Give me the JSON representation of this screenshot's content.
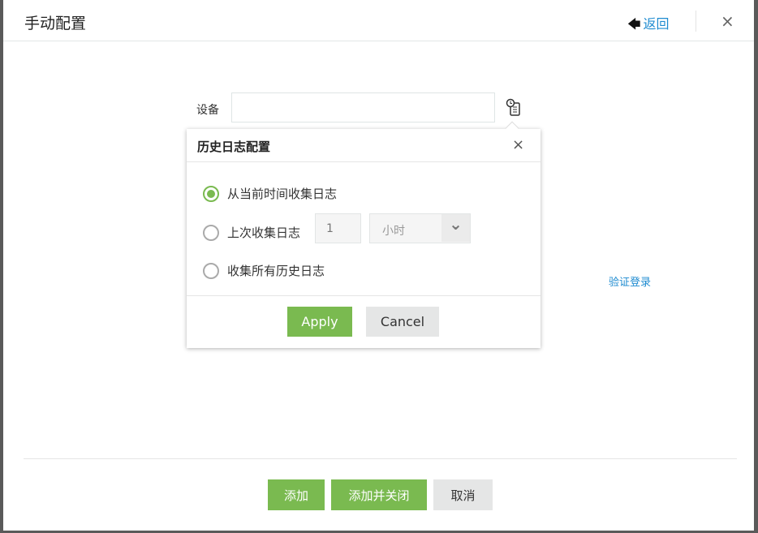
{
  "dialog": {
    "title": "手动配置",
    "back_label": "返回",
    "close_label": "×"
  },
  "form": {
    "device_label": "设备",
    "device_value": "",
    "verify_label": "验证登录"
  },
  "popover": {
    "title": "历史日志配置",
    "close_label": "×",
    "options": [
      {
        "label": "从当前时间收集日志",
        "selected": true
      },
      {
        "label": "上次收集日志",
        "selected": false
      },
      {
        "label": "收集所有历史日志",
        "selected": false
      }
    ],
    "amount_value": "1",
    "unit_value": "小时",
    "apply_label": "Apply",
    "cancel_label": "Cancel"
  },
  "footer": {
    "add_label": "添加",
    "add_close_label": "添加并关闭",
    "cancel_label": "取消"
  },
  "colors": {
    "accent": "#7aba50",
    "link": "#1e8bd0"
  }
}
